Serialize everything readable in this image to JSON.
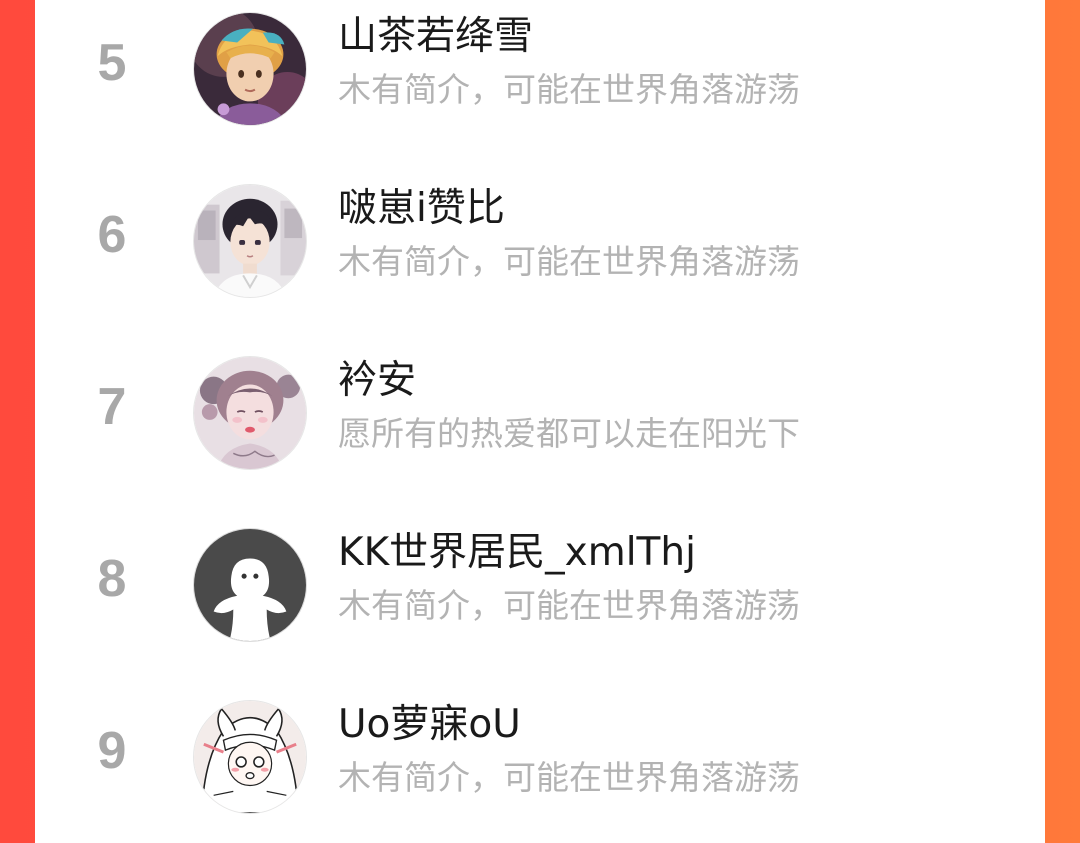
{
  "colors": {
    "background_gradient_start": "#ff4a3d",
    "background_gradient_end": "#ff7a3a",
    "card": "#ffffff",
    "rank_text": "#a8a8a8",
    "name_text": "#1a1a1a",
    "bio_text": "#b3b3b3"
  },
  "ranking": {
    "items": [
      {
        "rank": "5",
        "name": "山茶若绛雪",
        "bio": "木有简介，可能在世界角落游荡",
        "avatar_icon": "anime-boy-with-headband-avatar"
      },
      {
        "rank": "6",
        "name": "啵崽i赞比",
        "bio": "木有简介，可能在世界角落游荡",
        "avatar_icon": "anime-boy-dark-hair-avatar"
      },
      {
        "rank": "7",
        "name": "衿安",
        "bio": "愿所有的热爱都可以走在阳光下",
        "avatar_icon": "illustrated-girl-avatar"
      },
      {
        "rank": "8",
        "name": "KK世界居民_xmlThj",
        "bio": "木有简介，可能在世界角落游荡",
        "avatar_icon": "default-ghost-avatar"
      },
      {
        "rank": "9",
        "name": "Uo萝寐oU",
        "bio": "木有简介，可能在世界角落游荡",
        "avatar_icon": "manga-girl-avatar"
      }
    ]
  }
}
